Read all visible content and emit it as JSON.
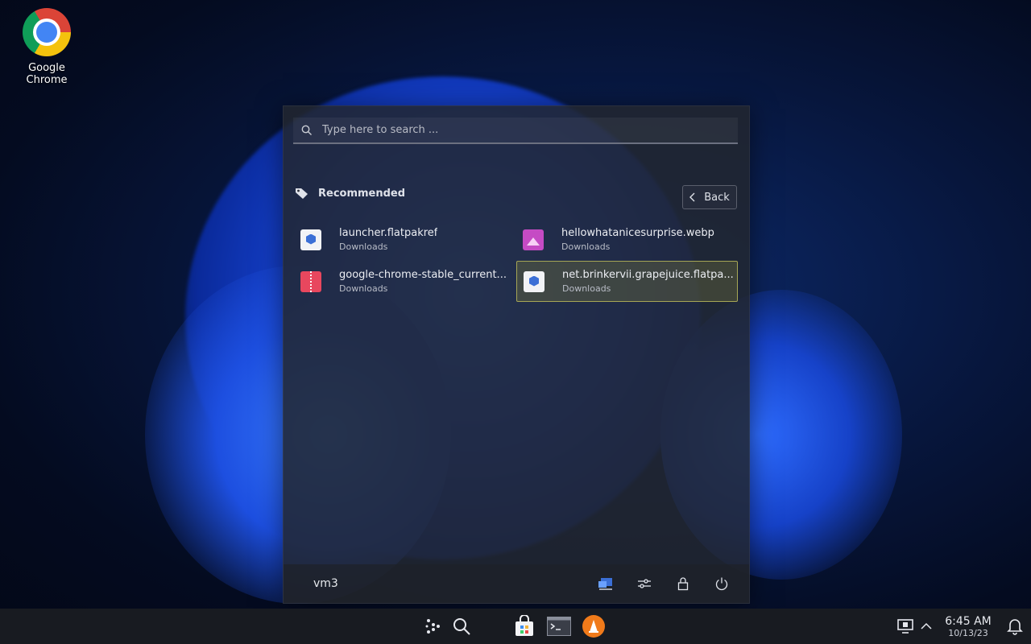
{
  "desktop": {
    "icons": [
      {
        "label": "Google Chrome",
        "icon": "chrome-icon"
      }
    ]
  },
  "launcher": {
    "search": {
      "placeholder": "Type here to search ...",
      "value": ""
    },
    "section": {
      "title": "Recommended",
      "icon": "tag-icon"
    },
    "back_label": "Back",
    "items": [
      {
        "name": "launcher.flatpakref",
        "location": "Downloads",
        "icon": "flatpak-package-icon"
      },
      {
        "name": "hellowhatanicesurprise.webp",
        "location": "Downloads",
        "icon": "image-file-icon"
      },
      {
        "name": "google-chrome-stable_current...",
        "location": "Downloads",
        "icon": "archive-file-icon"
      },
      {
        "name": "net.brinkervii.grapejuice.flatpa...",
        "location": "Downloads",
        "icon": "flatpak-package-icon",
        "highlighted": true
      }
    ],
    "footer": {
      "user": "vm3",
      "icons": [
        "switch-user-icon",
        "settings-sliders-icon",
        "lock-icon",
        "power-icon"
      ]
    }
  },
  "taskbar": {
    "icons": [
      "app-launcher-icon",
      "search-icon",
      "discover-store-icon",
      "terminal-icon",
      "vlc-icon"
    ],
    "tray": [
      "display-icon",
      "chevron-up-icon"
    ],
    "clock": {
      "time": "6:45 AM",
      "date": "10/13/23"
    },
    "notification_icon": "bell-icon"
  },
  "colors": {
    "highlight_border": "#a6a655",
    "accent": "#3b6fd6"
  }
}
